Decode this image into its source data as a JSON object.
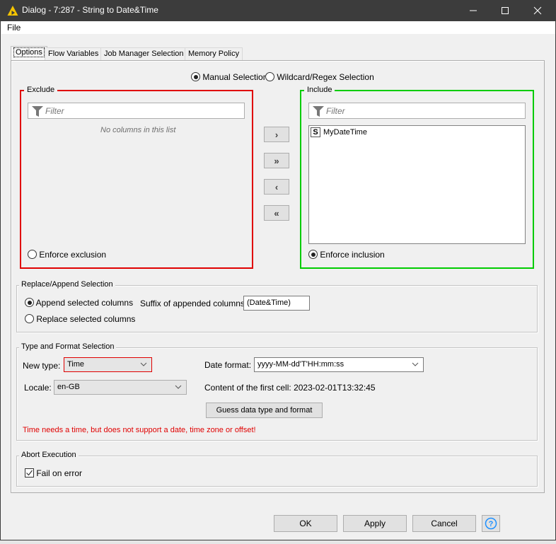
{
  "window": {
    "title": "Dialog - 7:287 - String to Date&Time",
    "icon": "knime-warning-triangle-icon",
    "controls": [
      "minimize",
      "maximize",
      "close"
    ]
  },
  "menu": {
    "items": [
      "File"
    ]
  },
  "tabs": [
    {
      "label": "Options",
      "active": true
    },
    {
      "label": "Flow Variables",
      "active": false
    },
    {
      "label": "Job Manager Selection",
      "active": false
    },
    {
      "label": "Memory Policy",
      "active": false
    }
  ],
  "selection_mode": {
    "options": [
      {
        "label": "Manual Selection",
        "selected": true
      },
      {
        "label": "Wildcard/Regex Selection",
        "selected": false
      }
    ]
  },
  "exclude": {
    "title": "Exclude",
    "filter_placeholder": "Filter",
    "empty_message": "No columns in this list",
    "enforce_label": "Enforce exclusion",
    "enforce_selected": false,
    "border_color": "#e00000"
  },
  "include": {
    "title": "Include",
    "filter_placeholder": "Filter",
    "items": [
      {
        "type_badge": "S",
        "name": "MyDateTime"
      }
    ],
    "enforce_label": "Enforce inclusion",
    "enforce_selected": true,
    "border_color": "#00cc00"
  },
  "move_buttons": [
    {
      "name": "add",
      "glyph": "›"
    },
    {
      "name": "add-all",
      "glyph": "»"
    },
    {
      "name": "remove",
      "glyph": "‹"
    },
    {
      "name": "remove-all",
      "glyph": "«"
    }
  ],
  "replace_append": {
    "title": "Replace/Append Selection",
    "append_label": "Append selected columns",
    "append_selected": true,
    "replace_label": "Replace selected columns",
    "replace_selected": false,
    "suffix_label": "Suffix of appended columns:",
    "suffix_value": "(Date&Time)"
  },
  "type_format": {
    "title": "Type and Format Selection",
    "new_type_label": "New type:",
    "new_type_value": "Time",
    "locale_label": "Locale:",
    "locale_value": "en-GB",
    "date_format_label": "Date format:",
    "date_format_value": "yyyy-MM-dd'T'HH:mm:ss",
    "first_cell_label": "Content of the first cell:",
    "first_cell_value": "2023-02-01T13:32:45",
    "guess_button": "Guess data type and format",
    "error_message": "Time needs a time, but does not support a date, time zone or offset!",
    "error_color": "#e00000"
  },
  "abort": {
    "title": "Abort Execution",
    "fail_on_error_label": "Fail on error",
    "fail_on_error_checked": true
  },
  "footer": {
    "ok": "OK",
    "apply": "Apply",
    "cancel": "Cancel",
    "help_icon": "help-icon"
  }
}
